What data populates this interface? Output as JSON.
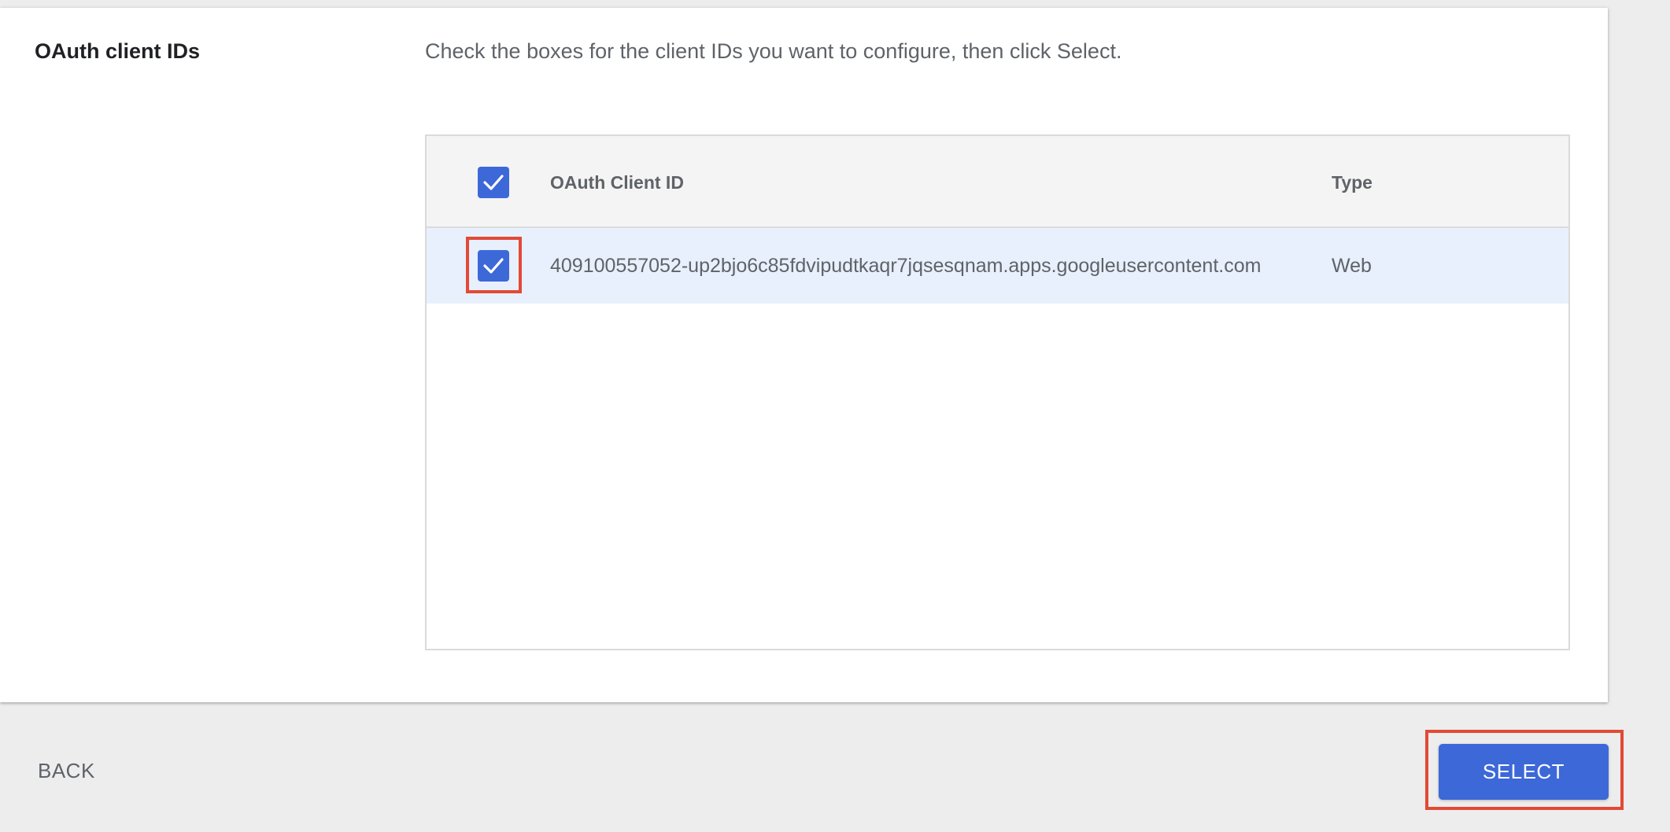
{
  "section": {
    "title": "OAuth client IDs",
    "description": "Check the boxes for the client IDs you want to configure, then click Select."
  },
  "table": {
    "columns": [
      "OAuth Client ID",
      "Type"
    ],
    "select_all_checked": true,
    "rows": [
      {
        "checked": true,
        "client_id": "409100557052-up2bjo6c85fdvipudtkaqr7jqsesqnam.apps.googleusercontent.com",
        "type": "Web"
      }
    ]
  },
  "footer": {
    "back_label": "BACK",
    "select_label": "SELECT"
  },
  "colors": {
    "accent": "#3d68d8",
    "highlight": "#e24a35",
    "selected_row": "#e8f0fd"
  },
  "icons": {
    "checkbox_check": "check-icon"
  }
}
